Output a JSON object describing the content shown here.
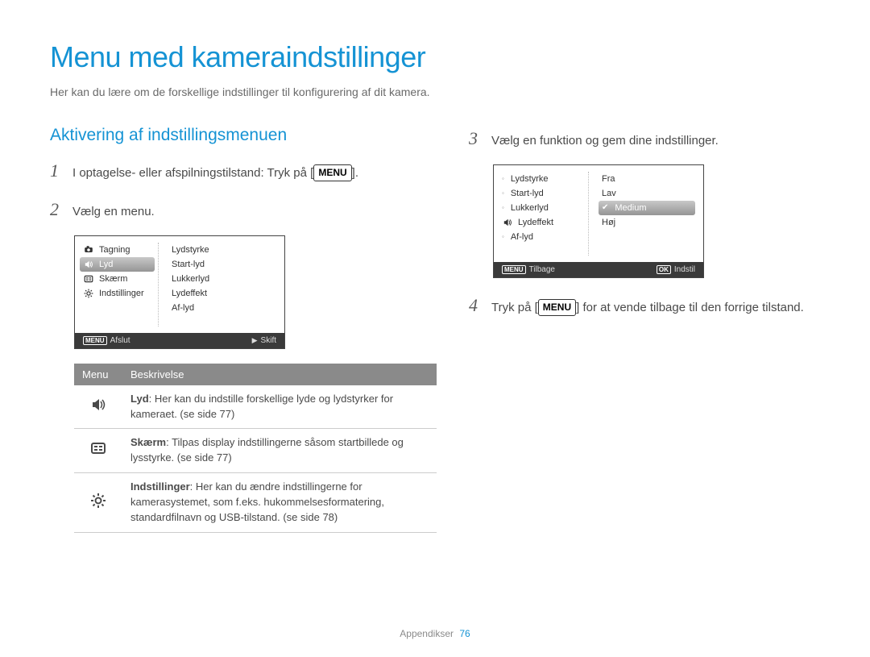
{
  "page_title": "Menu med kameraindstillinger",
  "intro": "Her kan du lære om de forskellige indstillinger til konfigurering af dit kamera.",
  "section_title": "Aktivering af indstillingsmenuen",
  "steps": {
    "s1_pre": "I optagelse- eller afspilningstilstand: Tryk på [",
    "s1_key": "MENU",
    "s1_post": "].",
    "s2": "Vælg en menu.",
    "s3": "Vælg en funktion og gem dine indstillinger.",
    "s4_pre": "Tryk på [",
    "s4_key": "MENU",
    "s4_post": "] for at vende tilbage til den forrige tilstand."
  },
  "lcd1": {
    "left": [
      {
        "icon": "camera",
        "label": "Tagning"
      },
      {
        "icon": "sound",
        "label": "Lyd",
        "selected": true
      },
      {
        "icon": "display",
        "label": "Skærm"
      },
      {
        "icon": "gear",
        "label": "Indstillinger"
      }
    ],
    "right": [
      "Lydstyrke",
      "Start-lyd",
      "Lukkerlyd",
      "Lydeffekt",
      "Af-lyd"
    ],
    "footer_left_key": "MENU",
    "footer_left": "Afslut",
    "footer_right_icon": "▶",
    "footer_right": "Skift"
  },
  "lcd2": {
    "left": [
      {
        "label": "Lydstyrke"
      },
      {
        "label": "Start-lyd"
      },
      {
        "label": "Lukkerlyd"
      },
      {
        "icon": "sound",
        "label": "Lydeffekt"
      },
      {
        "label": "Af-lyd"
      }
    ],
    "right": [
      {
        "label": "Fra"
      },
      {
        "label": "Lav"
      },
      {
        "label": "Medium",
        "selected": true,
        "checked": true
      },
      {
        "label": "Høj"
      }
    ],
    "footer_left_key": "MENU",
    "footer_left": "Tilbage",
    "footer_right_key": "OK",
    "footer_right": "Indstil"
  },
  "table": {
    "head": {
      "c1": "Menu",
      "c2": "Beskrivelse"
    },
    "rows": [
      {
        "icon": "sound",
        "bold": "Lyd",
        "text": ": Her kan du indstille forskellige lyde og lydstyrker for kameraet. (se side 77)"
      },
      {
        "icon": "display",
        "bold": "Skærm",
        "text": ": Tilpas display indstillingerne såsom startbillede og lysstyrke. (se side 77)"
      },
      {
        "icon": "gear",
        "bold": "Indstillinger",
        "text": ": Her kan du ændre indstillingerne for kamerasystemet, som f.eks. hukommelsesformatering, standardfilnavn og USB-tilstand. (se side 78)"
      }
    ]
  },
  "footer": {
    "label": "Appendikser",
    "page": "76"
  }
}
